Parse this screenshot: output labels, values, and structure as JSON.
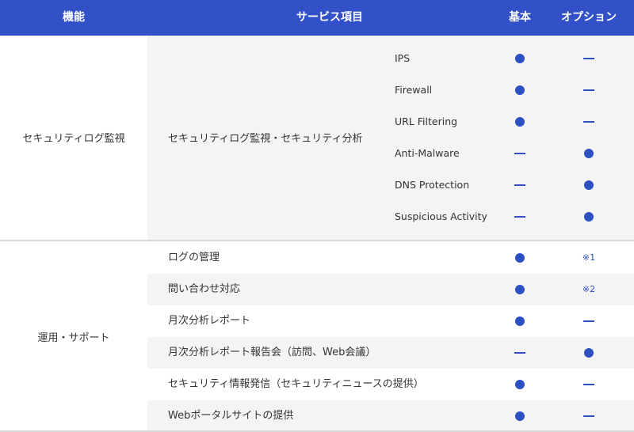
{
  "header": {
    "function": "機能",
    "service": "サービス項目",
    "basic": "基本",
    "option": "オプション"
  },
  "section1": {
    "category": "セキュリティログ監視",
    "service": "セキュリティログ監視・セキュリティ分析",
    "rows": [
      {
        "label": "IPS",
        "basic": "dot",
        "option": "dash"
      },
      {
        "label": "Firewall",
        "basic": "dot",
        "option": "dash"
      },
      {
        "label": "URL Filtering",
        "basic": "dot",
        "option": "dash"
      },
      {
        "label": "Anti-Malware",
        "basic": "dash",
        "option": "dot"
      },
      {
        "label": "DNS Protection",
        "basic": "dash",
        "option": "dot"
      },
      {
        "label": "Suspicious Activity",
        "basic": "dash",
        "option": "dot"
      }
    ]
  },
  "section2": {
    "category": "運用・サポート",
    "rows": [
      {
        "label": "ログの管理",
        "basic": "dot",
        "option": "※1"
      },
      {
        "label": "問い合わせ対応",
        "basic": "dot",
        "option": "※2"
      },
      {
        "label": "月次分析レポート",
        "basic": "dot",
        "option": "dash"
      },
      {
        "label": "月次分析レポート報告会（訪問、Web会議）",
        "basic": "dash",
        "option": "dot"
      },
      {
        "label": "セキュリティ情報発信（セキュリティニュースの提供）",
        "basic": "dot",
        "option": "dash"
      },
      {
        "label": "Webポータルサイトの提供",
        "basic": "dot",
        "option": "dash"
      }
    ]
  },
  "colors": {
    "header_bg": "#3250c8",
    "accent": "#2d4fc4",
    "row_shade": "#f4f4f4"
  }
}
